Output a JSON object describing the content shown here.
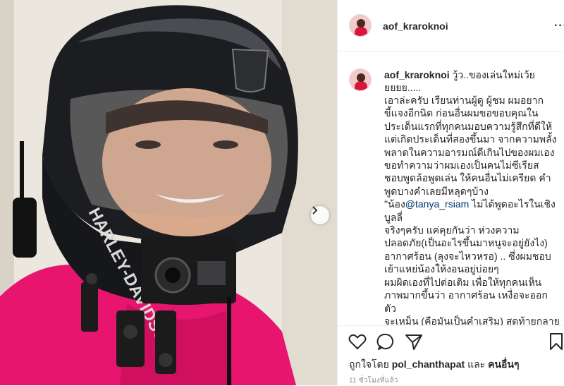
{
  "post": {
    "username": "aof_kraroknoi",
    "caption": {
      "username": "aof_kraroknoi",
      "headline": "วู้ว..ของเล่นใหม่เว้ย ยยยย.....",
      "body_part1": "เอาล่ะครับ เรียนท่านผู้ดู ผู้ชม ผมอยาก\nขี้แจงอีกนิด ก่อนอื่นผมขอขอบคุณใน\nประเด็นแรกที่ทุกคนมอบความรู้สึกที่ดีให้\nแต่เกิดประเด็นที่สองขึ้นมา จากความพลั้ง\nพลาดในความอารมณ์ดีเกินไปของผมเอง\nขอทำความว่าผมเองเป็นคนไม่ซีเรียส\nชอบพูดล้อพูดเล่น ให้คนอื่นไม่เครียด คำ\nพูดบางคำเลยมีหลุดๆบ้าง \"น้อง",
      "mention": "@tanya_rsiam",
      "body_part2": " ไม่ได้พูดอะไรในเชิงบูลลี่\nจริงๆครับ แค่คุยกันว่า ห่วงความ\nปลอดภัย(เป็นอะไรขึ้นมาหนูจะอยู่ยังไง)\nอากาศร้อน (ลุงจะไหวหรอ) .. ซึ่งผมชอบ\nเย้าแหย่น้องให้งอนอยู่บ่อยๆ\nผมผิดเองที่ไปต่อเติม เพื่อให้ทุกคนเห็น\nภาพมากขึ้นว่า อากาศร้อน เหงื่อจะออก ตัว\nจะเหม็น (คือมันเป็นคำเสริม) สุดท้ายกลาย\nเป็น \"มุกไม่ฮาพากันเครียด\" จนผมมาเห็น\nว่าสุดท้าย เป็นหัวข้อ ผมเองไม่สบายใจ"
    },
    "likes": {
      "prefix": "ถูกใจโดย",
      "user": "pol_chanthapat",
      "joiner": "และ",
      "others": "คนอื่นๆ"
    },
    "timestamp": "11 ชั่วโมงที่แล้ว"
  },
  "icons": {
    "like": "heart-icon",
    "comment": "comment-icon",
    "share": "share-icon",
    "save": "bookmark-icon",
    "more": "more-options-icon",
    "next": "chevron-right-icon"
  },
  "colors": {
    "text": "#262626",
    "muted": "#8e8e8e",
    "mention": "#00376b",
    "border": "#efefef",
    "shirt": "#e8156e"
  }
}
